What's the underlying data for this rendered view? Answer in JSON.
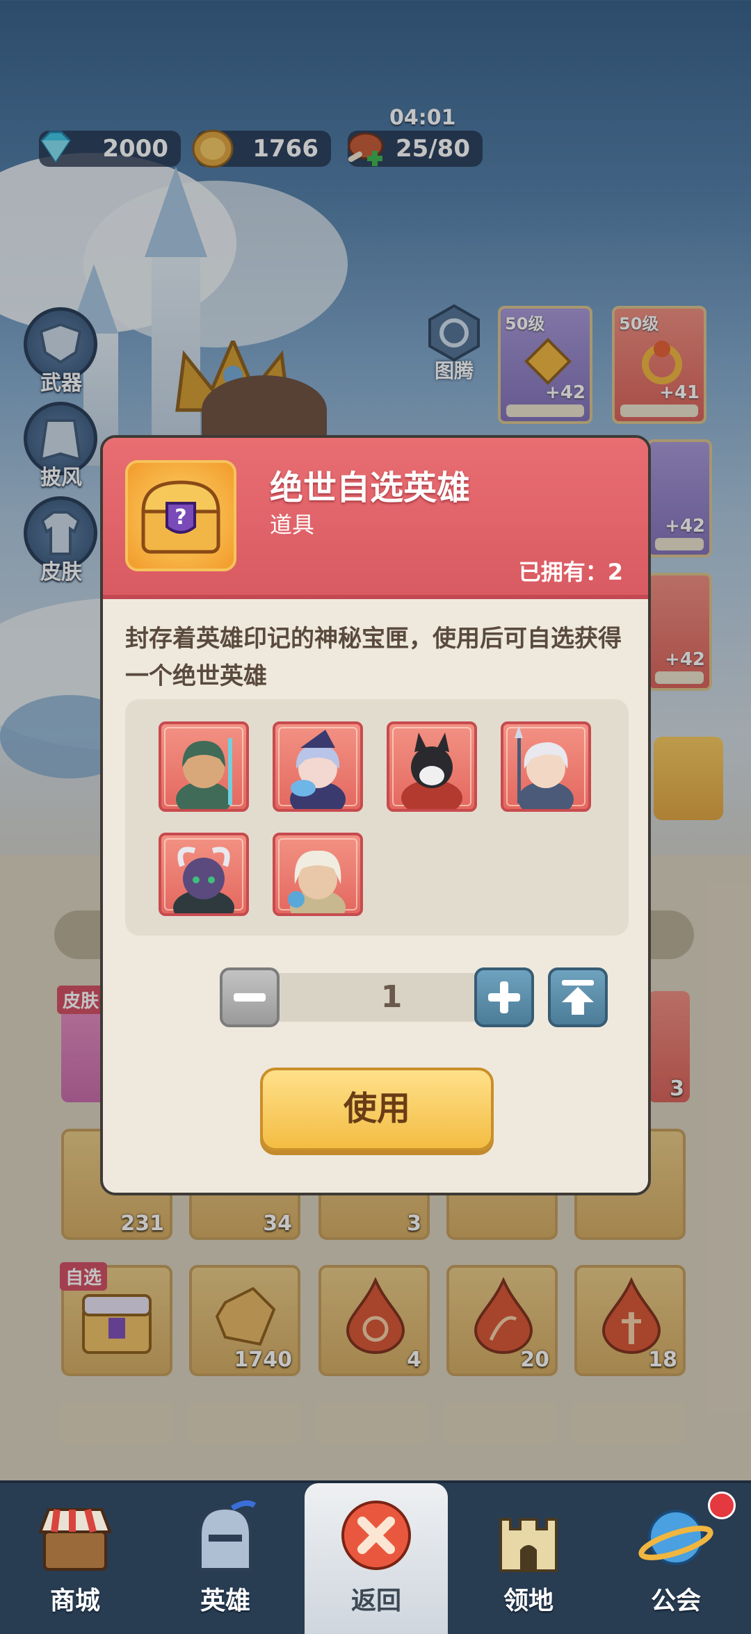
{
  "resources": {
    "gems": "2000",
    "gold": "1766",
    "stamina": "25/80",
    "stamina_timer": "04:01"
  },
  "side_menu": [
    {
      "label": "武器",
      "icon": "weapon-icon"
    },
    {
      "label": "披风",
      "icon": "cape-icon"
    },
    {
      "label": "皮肤",
      "icon": "skin-icon"
    }
  ],
  "totem": {
    "label": "图腾",
    "icon": "totem-icon"
  },
  "equipment": [
    {
      "level": "50级",
      "plus": "+42",
      "color": "#8e7dc7"
    },
    {
      "level": "50级",
      "plus": "+41",
      "color": "#e56a60"
    },
    {
      "plus": "+42",
      "color": "#8e7dc7"
    },
    {
      "plus": "+42",
      "color": "#e56a60"
    }
  ],
  "inventory": {
    "row1_tag": "皮肤",
    "row1_last_count": "3",
    "row2_counts": [
      "231",
      "34",
      "3",
      "",
      ""
    ],
    "row3": [
      {
        "tag": "自选",
        "count": "",
        "icon": "hero-chest-icon"
      },
      {
        "count": "1740",
        "icon": "gold-ore-icon"
      },
      {
        "count": "4",
        "icon": "swirl-drop-icon"
      },
      {
        "count": "20",
        "icon": "bow-drop-icon"
      },
      {
        "count": "18",
        "icon": "sword-drop-icon"
      }
    ]
  },
  "modal": {
    "title": "绝世自选英雄",
    "subtitle": "道具",
    "owned_label": "已拥有：2",
    "description": "封存着英雄印记的神秘宝匣，使用后可自选获得一个绝世英雄",
    "heroes": [
      {
        "name": "trident-hero",
        "hair": "#3f6b58",
        "skin": "#d9a87a",
        "accent": "#6fd0e0"
      },
      {
        "name": "witch-hero",
        "hair": "#b8c4e8",
        "skin": "#f2d8d0",
        "accent": "#3a3a6e"
      },
      {
        "name": "wolf-hero",
        "hair": "#2a2a2e",
        "skin": "#f0f0f0",
        "accent": "#b33a2e"
      },
      {
        "name": "spear-hero",
        "hair": "#e8e8ee",
        "skin": "#f2d8c4",
        "accent": "#4a5a78"
      },
      {
        "name": "horned-beast-hero",
        "hair": "#2e3a3e",
        "skin": "#5a4a7e",
        "accent": "#3fc07a"
      },
      {
        "name": "sage-hero",
        "hair": "#f0ece0",
        "skin": "#e8c8a8",
        "accent": "#5aa8d8"
      }
    ],
    "quantity": "1",
    "use_label": "使用"
  },
  "nav": [
    {
      "label": "商城",
      "icon": "shop-icon"
    },
    {
      "label": "英雄",
      "icon": "helmet-icon"
    },
    {
      "label": "返回",
      "icon": "close-icon"
    },
    {
      "label": "领地",
      "icon": "castle-icon"
    },
    {
      "label": "公会",
      "icon": "planet-icon"
    }
  ]
}
